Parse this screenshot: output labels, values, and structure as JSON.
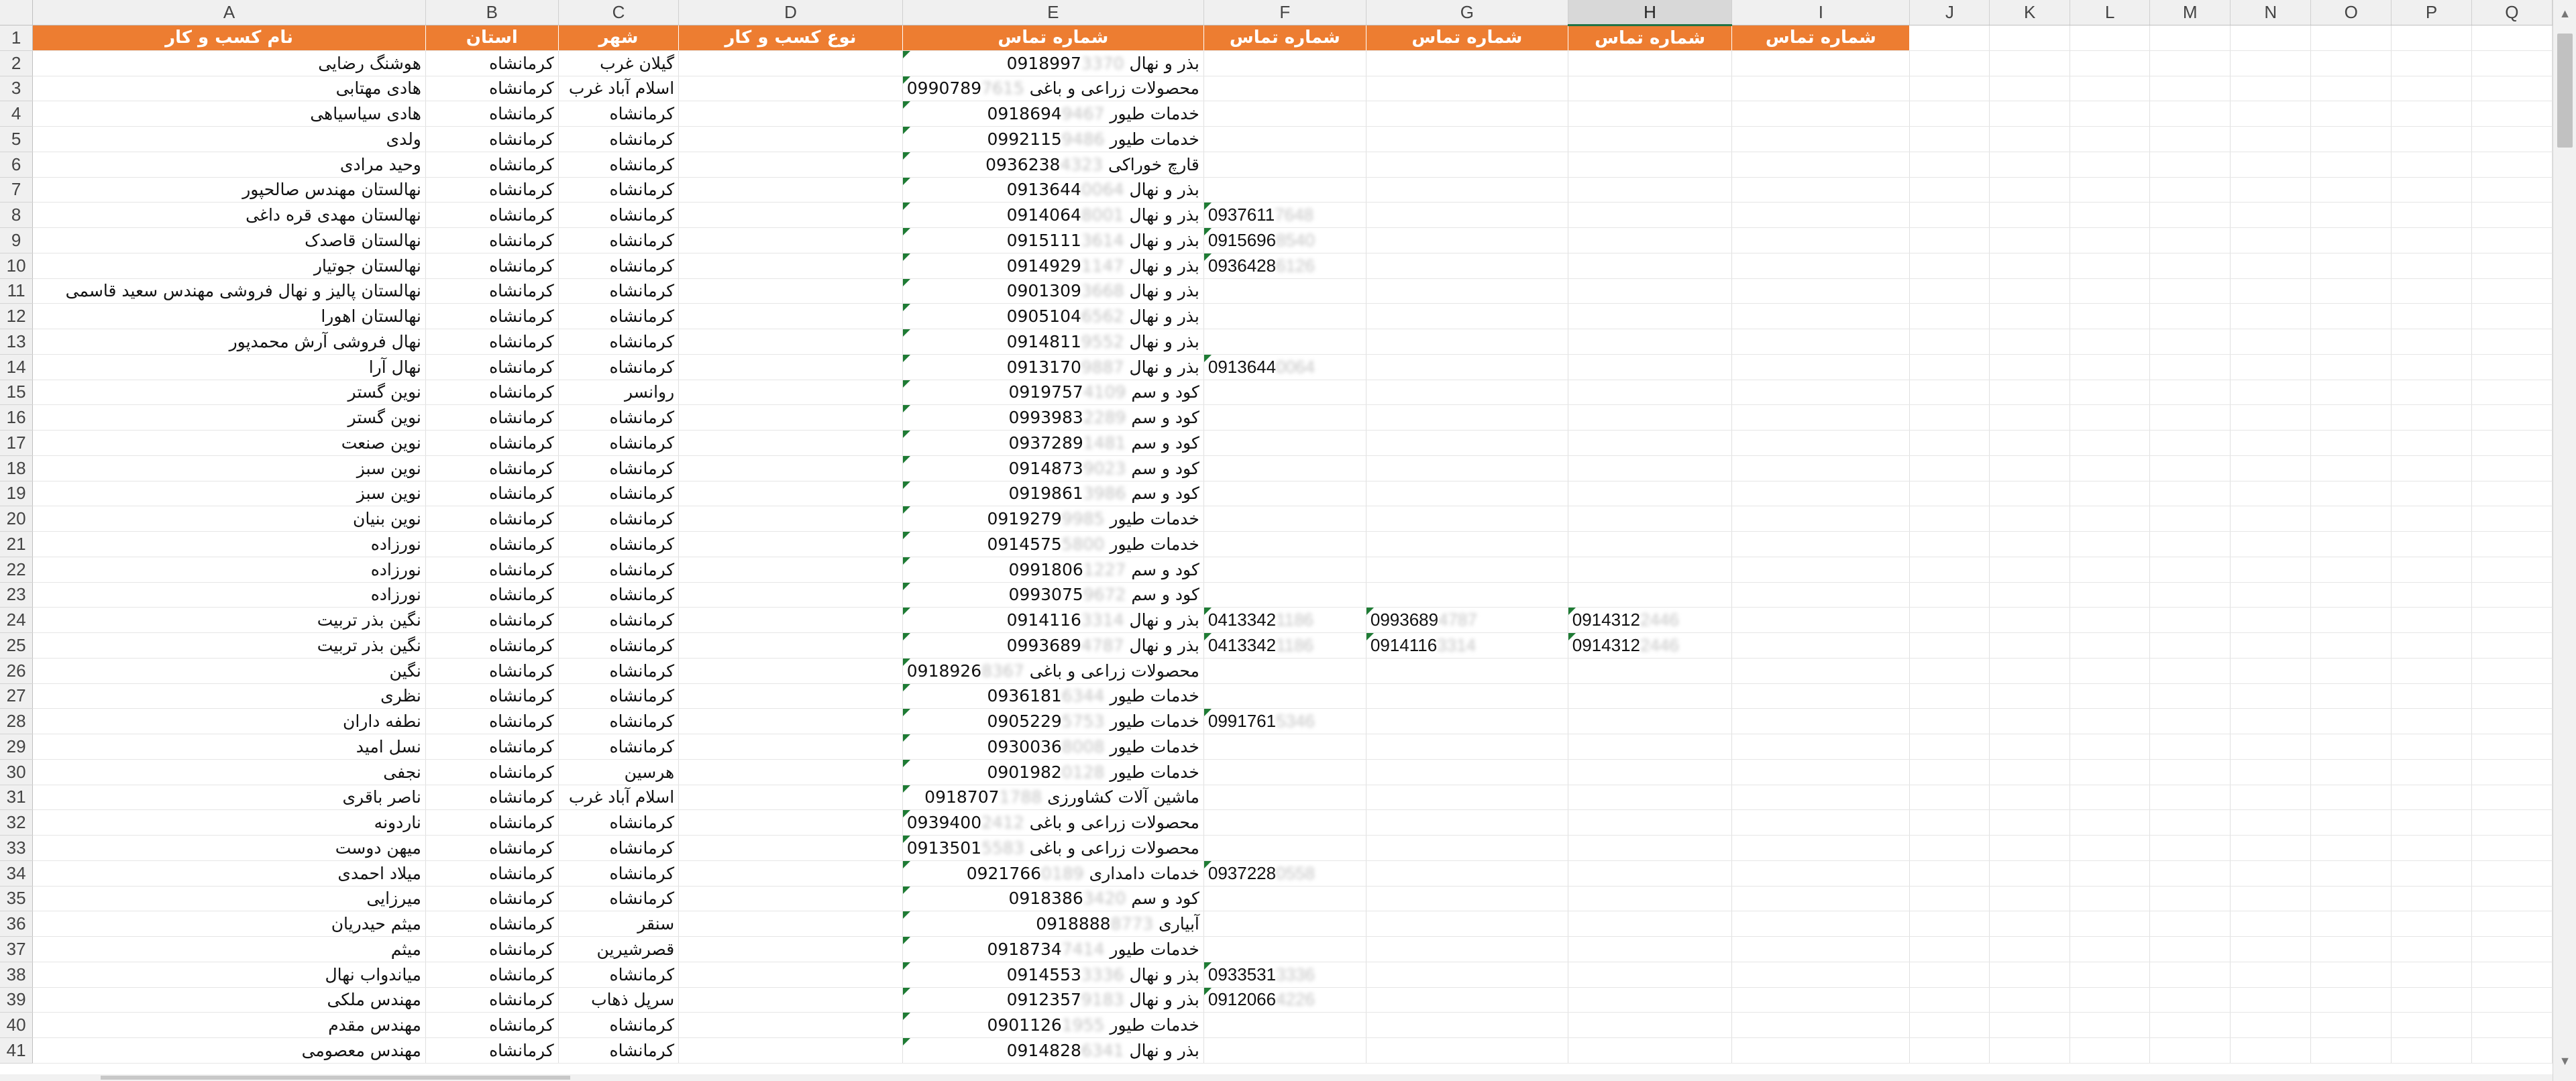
{
  "columns": [
    "A",
    "B",
    "C",
    "D",
    "E",
    "F",
    "G",
    "H",
    "I",
    "J",
    "K",
    "L",
    "M",
    "N",
    "O",
    "P",
    "Q"
  ],
  "selected_column": "H",
  "header_row": {
    "A": "نام کسب و کار",
    "B": "استان",
    "C": "شهر",
    "D": "نوع کسب و کار",
    "E": "شماره تماس",
    "F": "شماره تماس",
    "G": "شماره تماس",
    "H": "شماره تماس",
    "I": "شماره تماس"
  },
  "rows": [
    {
      "n": 2,
      "A": "هوشنگ رضایی",
      "B": "کرمانشاه",
      "C": "گیلان غرب",
      "D": "بذر و نهال",
      "E": [
        "0918997",
        "3370"
      ]
    },
    {
      "n": 3,
      "A": "هادی مهتابی",
      "B": "کرمانشاه",
      "C": "اسلام آباد غرب",
      "D": "محصولات زراعی و باغی",
      "E": [
        "0990789",
        "7615"
      ]
    },
    {
      "n": 4,
      "A": "هادی سیاسیاهی",
      "B": "کرمانشاه",
      "C": "کرمانشاه",
      "D": "خدمات طیور",
      "E": [
        "0918694",
        "9467"
      ]
    },
    {
      "n": 5,
      "A": "ولدی",
      "B": "کرمانشاه",
      "C": "کرمانشاه",
      "D": "خدمات طیور",
      "E": [
        "0992115",
        "9486"
      ]
    },
    {
      "n": 6,
      "A": "وحید مرادی",
      "B": "کرمانشاه",
      "C": "کرمانشاه",
      "D": "قارچ خوراکی",
      "E": [
        "0936238",
        "4323"
      ]
    },
    {
      "n": 7,
      "A": "نهالستان مهندس صالحپور",
      "B": "کرمانشاه",
      "C": "کرمانشاه",
      "D": "بذر و نهال",
      "E": [
        "0913644",
        "0064"
      ]
    },
    {
      "n": 8,
      "A": "نهالستان مهدی قره داغی",
      "B": "کرمانشاه",
      "C": "کرمانشاه",
      "D": "بذر و نهال",
      "E": [
        "0914064",
        "8001"
      ],
      "F": [
        "0937611",
        "7648"
      ]
    },
    {
      "n": 9,
      "A": "نهالستان قاصدک",
      "B": "کرمانشاه",
      "C": "کرمانشاه",
      "D": "بذر و نهال",
      "E": [
        "0915111",
        "3614"
      ],
      "F": [
        "0915696",
        "8540"
      ]
    },
    {
      "n": 10,
      "A": "نهالستان جوتیار",
      "B": "کرمانشاه",
      "C": "کرمانشاه",
      "D": "بذر و نهال",
      "E": [
        "0914929",
        "1147"
      ],
      "F": [
        "0936428",
        "6126"
      ]
    },
    {
      "n": 11,
      "A": "نهالستان پالیز و نهال فروشی مهندس سعید قاسمی",
      "B": "کرمانشاه",
      "C": "کرمانشاه",
      "D": "بذر و نهال",
      "E": [
        "0901309",
        "3668"
      ]
    },
    {
      "n": 12,
      "A": "نهالستان اهورا",
      "B": "کرمانشاه",
      "C": "کرمانشاه",
      "D": "بذر و نهال",
      "E": [
        "0905104",
        "6562"
      ]
    },
    {
      "n": 13,
      "A": "نهال فروشی آرش محمدپور",
      "B": "کرمانشاه",
      "C": "کرمانشاه",
      "D": "بذر و نهال",
      "E": [
        "0914811",
        "9552"
      ]
    },
    {
      "n": 14,
      "A": "نهال آرا",
      "B": "کرمانشاه",
      "C": "کرمانشاه",
      "D": "بذر و نهال",
      "E": [
        "0913170",
        "9887"
      ],
      "F": [
        "0913644",
        "0064"
      ]
    },
    {
      "n": 15,
      "A": "نوین گستر",
      "B": "کرمانشاه",
      "C": "روانسر",
      "D": "کود و سم",
      "E": [
        "0919757",
        "4109"
      ]
    },
    {
      "n": 16,
      "A": "نوین گستر",
      "B": "کرمانشاه",
      "C": "کرمانشاه",
      "D": "کود و سم",
      "E": [
        "0993983",
        "2289"
      ]
    },
    {
      "n": 17,
      "A": "نوین صنعت",
      "B": "کرمانشاه",
      "C": "کرمانشاه",
      "D": "کود و سم",
      "E": [
        "0937289",
        "1481"
      ]
    },
    {
      "n": 18,
      "A": "نوین سبز",
      "B": "کرمانشاه",
      "C": "کرمانشاه",
      "D": "کود و سم",
      "E": [
        "0914873",
        "9023"
      ]
    },
    {
      "n": 19,
      "A": "نوین سبز",
      "B": "کرمانشاه",
      "C": "کرمانشاه",
      "D": "کود و سم",
      "E": [
        "0919861",
        "3986"
      ]
    },
    {
      "n": 20,
      "A": "نوین بنیان",
      "B": "کرمانشاه",
      "C": "کرمانشاه",
      "D": "خدمات طیور",
      "E": [
        "0919279",
        "9985"
      ]
    },
    {
      "n": 21,
      "A": "نورزاده",
      "B": "کرمانشاه",
      "C": "کرمانشاه",
      "D": "خدمات طیور",
      "E": [
        "0914575",
        "5800"
      ]
    },
    {
      "n": 22,
      "A": "نورزاده",
      "B": "کرمانشاه",
      "C": "کرمانشاه",
      "D": "کود و سم",
      "E": [
        "0991806",
        "1227"
      ]
    },
    {
      "n": 23,
      "A": "نورزاده",
      "B": "کرمانشاه",
      "C": "کرمانشاه",
      "D": "کود و سم",
      "E": [
        "0993075",
        "9672"
      ]
    },
    {
      "n": 24,
      "A": "نگین بذر تربیت",
      "B": "کرمانشاه",
      "C": "کرمانشاه",
      "D": "بذر و نهال",
      "E": [
        "0914116",
        "3314"
      ],
      "F": [
        "0413342",
        "1186"
      ],
      "G": [
        "0993689",
        "4787"
      ],
      "H": [
        "0914312",
        "2446"
      ]
    },
    {
      "n": 25,
      "A": "نگین بذر تربیت",
      "B": "کرمانشاه",
      "C": "کرمانشاه",
      "D": "بذر و نهال",
      "E": [
        "0993689",
        "4787"
      ],
      "F": [
        "0413342",
        "1186"
      ],
      "G": [
        "0914116",
        "3314"
      ],
      "H": [
        "0914312",
        "2446"
      ]
    },
    {
      "n": 26,
      "A": "نگین",
      "B": "کرمانشاه",
      "C": "کرمانشاه",
      "D": "محصولات زراعی و باغی",
      "E": [
        "0918926",
        "8367"
      ]
    },
    {
      "n": 27,
      "A": "نظری",
      "B": "کرمانشاه",
      "C": "کرمانشاه",
      "D": "خدمات طیور",
      "E": [
        "0936181",
        "6344"
      ]
    },
    {
      "n": 28,
      "A": "نطفه داران",
      "B": "کرمانشاه",
      "C": "کرمانشاه",
      "D": "خدمات طیور",
      "E": [
        "0905229",
        "5753"
      ],
      "F": [
        "0991761",
        "5346"
      ]
    },
    {
      "n": 29,
      "A": "نسل امید",
      "B": "کرمانشاه",
      "C": "کرمانشاه",
      "D": "خدمات طیور",
      "E": [
        "0930036",
        "8008"
      ]
    },
    {
      "n": 30,
      "A": "نجفی",
      "B": "کرمانشاه",
      "C": "هرسین",
      "D": "خدمات طیور",
      "E": [
        "0901982",
        "0128"
      ]
    },
    {
      "n": 31,
      "A": "ناصر باقری",
      "B": "کرمانشاه",
      "C": "اسلام آباد غرب",
      "D": "ماشین آلات کشاورزی",
      "E": [
        "0918707",
        "1788"
      ]
    },
    {
      "n": 32,
      "A": "ناردونه",
      "B": "کرمانشاه",
      "C": "کرمانشاه",
      "D": "محصولات زراعی و باغی",
      "E": [
        "0939400",
        "2412"
      ]
    },
    {
      "n": 33,
      "A": "میهن دوست",
      "B": "کرمانشاه",
      "C": "کرمانشاه",
      "D": "محصولات زراعی و باغی",
      "E": [
        "0913501",
        "5583"
      ]
    },
    {
      "n": 34,
      "A": "میلاد احمدی",
      "B": "کرمانشاه",
      "C": "کرمانشاه",
      "D": "خدمات دامداری",
      "E": [
        "0921766",
        "0189"
      ],
      "F": [
        "0937228",
        "0558"
      ]
    },
    {
      "n": 35,
      "A": "میرزایی",
      "B": "کرمانشاه",
      "C": "کرمانشاه",
      "D": "کود و سم",
      "E": [
        "0918386",
        "3420"
      ]
    },
    {
      "n": 36,
      "A": "میثم حیدریان",
      "B": "کرمانشاه",
      "C": "سنقر",
      "D": "آبیاری",
      "E": [
        "0918888",
        "8773"
      ]
    },
    {
      "n": 37,
      "A": "میثم",
      "B": "کرمانشاه",
      "C": "قصرشیرین",
      "D": "خدمات طیور",
      "E": [
        "0918734",
        "7414"
      ]
    },
    {
      "n": 38,
      "A": "میاندواب نهال",
      "B": "کرمانشاه",
      "C": "کرمانشاه",
      "D": "بذر و نهال",
      "E": [
        "0914553",
        "3336"
      ],
      "F": [
        "0933531",
        "3336"
      ]
    },
    {
      "n": 39,
      "A": "مهندس ملکی",
      "B": "کرمانشاه",
      "C": "سرپل ذهاب",
      "D": "بذر و نهال",
      "E": [
        "0912357",
        "9183"
      ],
      "F": [
        "0912066",
        "4226"
      ]
    },
    {
      "n": 40,
      "A": "مهندس مقدم",
      "B": "کرمانشاه",
      "C": "کرمانشاه",
      "D": "خدمات طیور",
      "E": [
        "0901126",
        "1955"
      ]
    },
    {
      "n": 41,
      "A": "مهندس معصومی",
      "B": "کرمانشاه",
      "C": "کرمانشاه",
      "D": "بذر و نهال",
      "E": [
        "0914828",
        "6341"
      ]
    }
  ],
  "colors": {
    "header_fill": "#ed7d31",
    "header_text": "#ffffff",
    "selected_accent": "#217346",
    "error_flag": "#1e7b34"
  }
}
